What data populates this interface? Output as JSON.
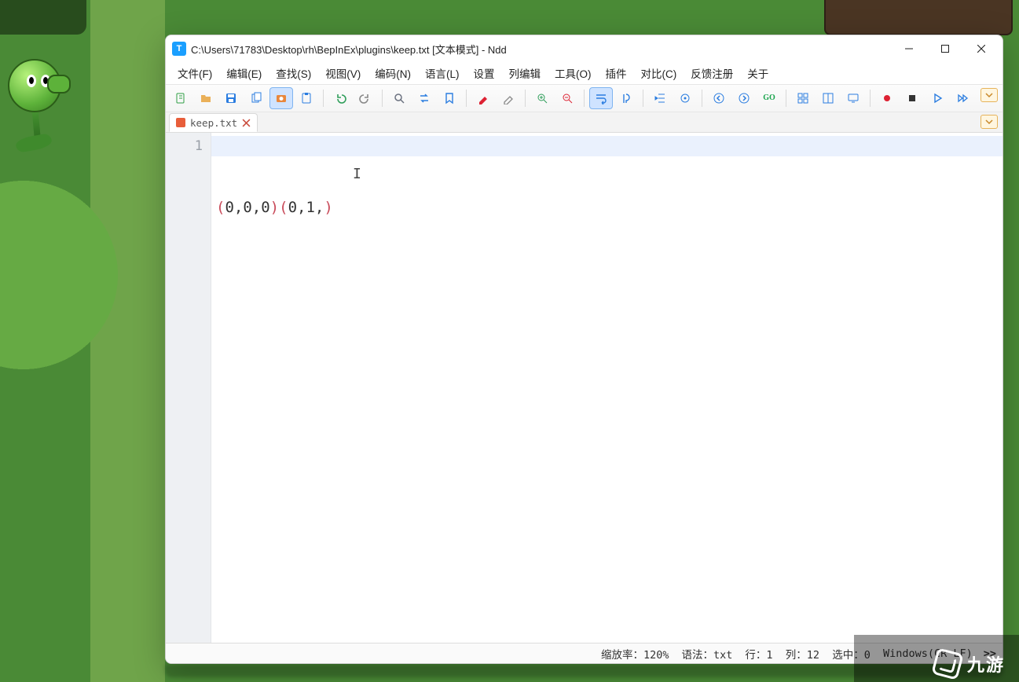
{
  "window": {
    "title": "C:\\Users\\71783\\Desktop\\rh\\BepInEx\\plugins\\keep.txt [文本模式] - Ndd",
    "icon_letter": "T"
  },
  "menu": {
    "items": [
      {
        "id": "file",
        "label": "文件(F)"
      },
      {
        "id": "edit",
        "label": "编辑(E)"
      },
      {
        "id": "search",
        "label": "查找(S)"
      },
      {
        "id": "view",
        "label": "视图(V)"
      },
      {
        "id": "encoding",
        "label": "编码(N)"
      },
      {
        "id": "language",
        "label": "语言(L)"
      },
      {
        "id": "settings",
        "label": "设置"
      },
      {
        "id": "coledit",
        "label": "列编辑"
      },
      {
        "id": "tools",
        "label": "工具(O)"
      },
      {
        "id": "plugins",
        "label": "插件"
      },
      {
        "id": "compare",
        "label": "对比(C)"
      },
      {
        "id": "feedback",
        "label": "反馈注册"
      },
      {
        "id": "about",
        "label": "关于"
      }
    ]
  },
  "toolbar": {
    "buttons": [
      {
        "id": "new",
        "name": "new-file-icon",
        "color": "#2f9e44"
      },
      {
        "id": "open",
        "name": "open-folder-icon",
        "color": "#e8a33d"
      },
      {
        "id": "save",
        "name": "save-icon",
        "color": "#2b7de0"
      },
      {
        "id": "copy",
        "name": "copy-icon",
        "color": "#2b7de0"
      },
      {
        "id": "screenshot",
        "name": "camera-icon",
        "color": "#e8873d",
        "active": true
      },
      {
        "id": "paste",
        "name": "paste-icon",
        "color": "#2b7de0"
      },
      {
        "sep": true
      },
      {
        "id": "undo",
        "name": "undo-icon",
        "color": "#2f9e5a"
      },
      {
        "id": "redo",
        "name": "redo-icon",
        "color": "#888"
      },
      {
        "sep": true
      },
      {
        "id": "find",
        "name": "find-icon",
        "color": "#6b7280"
      },
      {
        "id": "replace",
        "name": "replace-icon",
        "color": "#2b7de0"
      },
      {
        "id": "bookmark",
        "name": "bookmark-icon",
        "color": "#2b7de0"
      },
      {
        "sep": true
      },
      {
        "id": "mark-red",
        "name": "marker-red-icon",
        "color": "#d23"
      },
      {
        "id": "mark-clear",
        "name": "marker-clear-icon",
        "color": "#888"
      },
      {
        "sep": true
      },
      {
        "id": "zoom-in",
        "name": "zoom-in-icon",
        "color": "#2f9e5a"
      },
      {
        "id": "zoom-out",
        "name": "zoom-out-icon",
        "color": "#d23"
      },
      {
        "sep": true
      },
      {
        "id": "wrap",
        "name": "word-wrap-icon",
        "color": "#2b7de0",
        "active": true
      },
      {
        "id": "pilcrow",
        "name": "show-symbols-icon",
        "color": "#2b7de0"
      },
      {
        "sep": true
      },
      {
        "id": "indent",
        "name": "indent-icon",
        "color": "#2b7de0"
      },
      {
        "id": "target",
        "name": "target-icon",
        "color": "#2b7de0"
      },
      {
        "sep": true
      },
      {
        "id": "arrow-left",
        "name": "nav-prev-icon",
        "color": "#2b7de0"
      },
      {
        "id": "arrow-right",
        "name": "nav-next-icon",
        "color": "#2b7de0"
      },
      {
        "id": "go",
        "name": "goto-icon",
        "color": "#16a34a",
        "text": "GO"
      },
      {
        "sep": true
      },
      {
        "id": "grid",
        "name": "grid-icon",
        "color": "#2b7de0"
      },
      {
        "id": "split",
        "name": "split-icon",
        "color": "#2b7de0"
      },
      {
        "id": "monitor",
        "name": "monitor-icon",
        "color": "#2b7de0"
      },
      {
        "sep": true
      },
      {
        "id": "record",
        "name": "record-icon",
        "color": "#d23"
      },
      {
        "id": "stop",
        "name": "stop-icon",
        "color": "#333"
      },
      {
        "id": "play",
        "name": "play-icon",
        "color": "#2b7de0"
      },
      {
        "id": "fast",
        "name": "fast-forward-icon",
        "color": "#2b7de0"
      }
    ]
  },
  "tabs": {
    "items": [
      {
        "filename": "keep.txt",
        "dirty": true
      }
    ]
  },
  "editor": {
    "line_numbers": [
      "1"
    ],
    "code_html": "<span class=\"p\">(</span><span class=\"t\">0,0,0</span><span class=\"p\">)</span><span class=\"p\">(</span><span class=\"t\">0,1,</span><span class=\"p\">)</span>"
  },
  "statusbar": {
    "zoom_label": "缩放率：",
    "zoom_value": "120%",
    "syntax_label": "语法：",
    "syntax_value": "txt",
    "line_label": "行：",
    "line_value": "1",
    "col_label": "列：",
    "col_value": "12",
    "sel_label": "选中：",
    "sel_value": "0",
    "eol_value": "Windows(CR LF)",
    "overflow": ">>"
  },
  "background": {
    "bottom_brand": "九游"
  }
}
